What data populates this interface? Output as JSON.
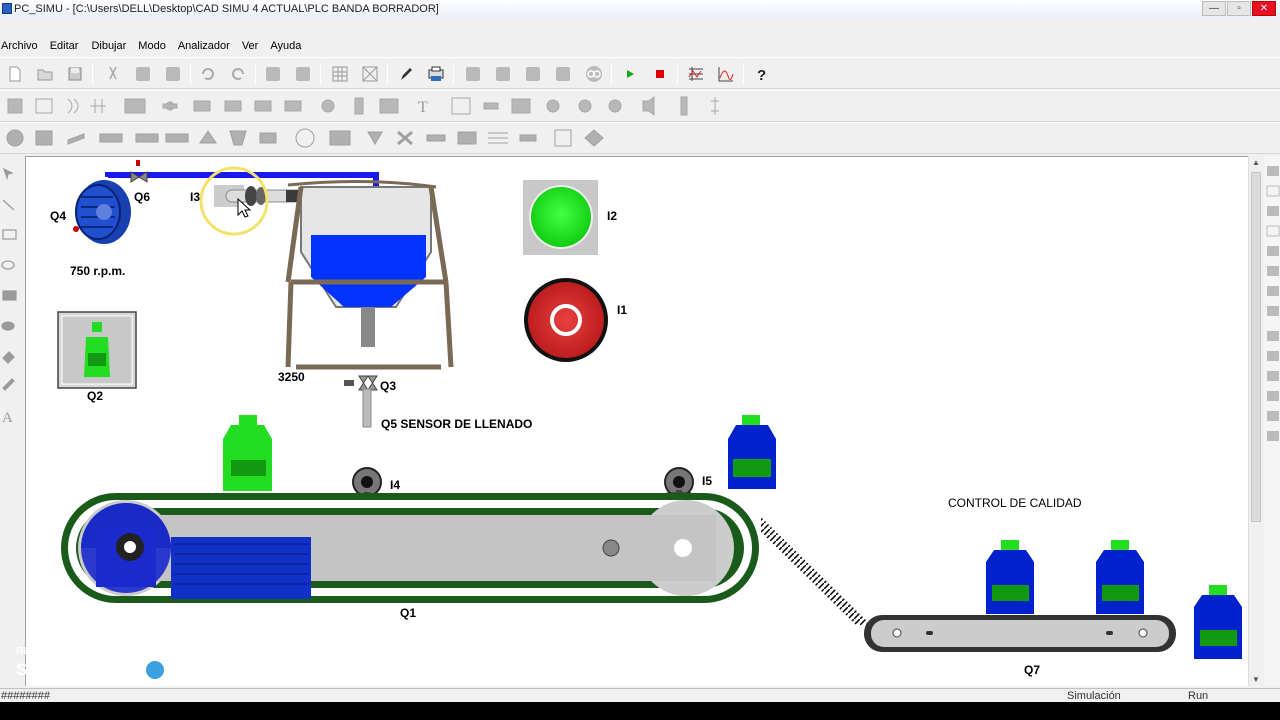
{
  "window": {
    "title": "PC_SIMU - [C:\\Users\\DELL\\Desktop\\CAD SIMU 4 ACTUAL\\PLC BANDA BORRADOR]"
  },
  "menu": [
    "Archivo",
    "Editar",
    "Dibujar",
    "Modo",
    "Analizador",
    "Ver",
    "Ayuda"
  ],
  "toolbar1": [
    "new-icon",
    "open-icon",
    "save-icon",
    "cut-icon",
    "copy-icon",
    "paste-icon",
    "undo-icon",
    "redo-icon",
    "zoom-in-icon",
    "zoom-out-icon",
    "grid-icon",
    "crosshair-icon",
    "pen-icon",
    "printer-icon",
    "component-icon",
    "component-icon",
    "component-icon",
    "component-icon",
    "link-icon",
    "play-icon",
    "stop-icon",
    "analyzer-icon",
    "chart-icon",
    "help-icon"
  ],
  "canvas": {
    "motor": {
      "label": "Q4",
      "speed": "750 r.p.m."
    },
    "valve_top": "Q6",
    "sensor_top": "I3",
    "tank": {
      "value": "3250",
      "fill_level": 0.45
    },
    "valve_bottom": "Q3",
    "fill_sensor": "Q5  SENSOR DE LLENADO",
    "bottle_indicator": "Q2",
    "start_button": "I2",
    "stop_button": "I1",
    "sensor_left": "I4",
    "sensor_right": "I5",
    "main_conveyor": "Q1",
    "quality_title": "CONTROL DE CALIDAD",
    "qc_conveyor": "Q7"
  },
  "status": {
    "left": "########",
    "mode": "Simulación",
    "state": "Run"
  },
  "watermark": {
    "line1": "RECORDED WITH",
    "line2a": "SCREENCAST",
    "line2b": "MATIC"
  },
  "colors": {
    "tank_fill": "#0033ff",
    "pipe": "#0000ee",
    "bottle_green": "#22dd22",
    "bottle_blue": "#0022cc",
    "belt": "#1a5a1a",
    "start": "#22ee22",
    "stop": "#d82a2a"
  }
}
